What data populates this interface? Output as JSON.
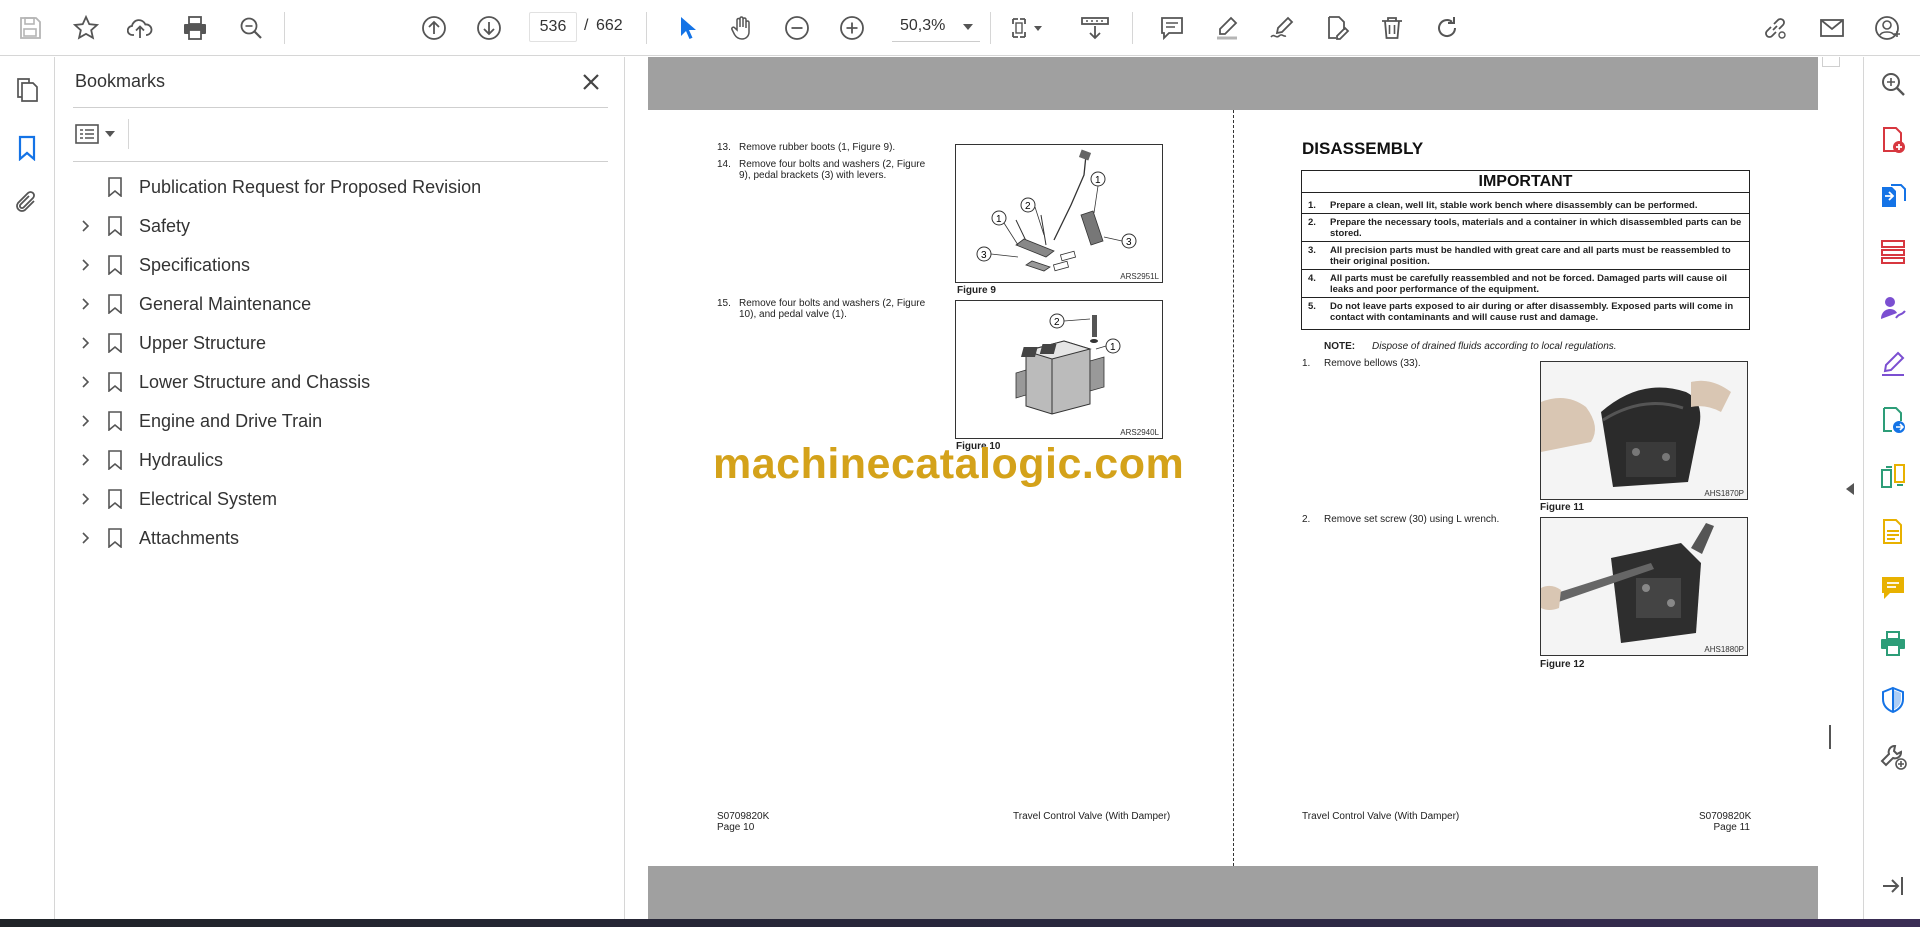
{
  "toolbar": {
    "current_page": "536",
    "page_separator": "/",
    "total_pages": "662",
    "zoom": "50,3%"
  },
  "bookmarks": {
    "title": "Bookmarks",
    "items": [
      {
        "label": "Publication Request for Proposed Revision",
        "expandable": false
      },
      {
        "label": "Safety",
        "expandable": true
      },
      {
        "label": "Specifications",
        "expandable": true
      },
      {
        "label": "General Maintenance",
        "expandable": true
      },
      {
        "label": "Upper Structure",
        "expandable": true
      },
      {
        "label": "Lower Structure and Chassis",
        "expandable": true
      },
      {
        "label": "Engine and Drive Train",
        "expandable": true
      },
      {
        "label": "Hydraulics",
        "expandable": true
      },
      {
        "label": "Electrical System",
        "expandable": true
      },
      {
        "label": "Attachments",
        "expandable": true
      }
    ]
  },
  "left_page": {
    "steps": [
      {
        "num": "13.",
        "text": "Remove rubber boots (1, Figure 9)."
      },
      {
        "num": "14.",
        "line1": "Remove four bolts and washers (2, Figure",
        "line2": "9), pedal brackets (3) with levers."
      },
      {
        "num": "15.",
        "line1": "Remove four bolts and washers (2, Figure",
        "line2": "10), and pedal valve (1)."
      }
    ],
    "figures": [
      {
        "caption": "Figure 9",
        "code": "ARS2951L"
      },
      {
        "caption": "Figure 10",
        "code": "ARS2940L"
      }
    ],
    "footer": {
      "doc_no": "S0709820K",
      "page": "Page 10",
      "title": "Travel Control Valve (With Damper)"
    }
  },
  "right_page": {
    "heading": "DISASSEMBLY",
    "important": {
      "title": "IMPORTANT",
      "items": [
        {
          "num": "1.",
          "line1": "Prepare a clean, well lit, stable work bench where disassembly can be performed.",
          "line2": ""
        },
        {
          "num": "2.",
          "line1": "Prepare the necessary tools, materials and a container in which disassembled parts can be",
          "line2": "stored."
        },
        {
          "num": "3.",
          "line1": "All precision parts must be handled with great care and all parts must be reassembled to",
          "line2": "their original position."
        },
        {
          "num": "4.",
          "line1": "All parts must be carefully reassembled and not be forced. Damaged parts will cause oil",
          "line2": "leaks and poor performance of the equipment."
        },
        {
          "num": "5.",
          "line1": "Do not leave parts exposed to air during or after disassembly. Exposed parts will come in",
          "line2": "contact with contaminants and will cause rust and damage."
        }
      ]
    },
    "note_label": "NOTE:",
    "note_text": "Dispose of drained fluids according to local regulations.",
    "steps": [
      {
        "num": "1.",
        "text": "Remove bellows (33)."
      },
      {
        "num": "2.",
        "text": "Remove set screw (30) using L wrench."
      }
    ],
    "figures": [
      {
        "caption": "Figure 11",
        "code": "AHS1870P"
      },
      {
        "caption": "Figure 12",
        "code": "AHS1880P"
      }
    ],
    "footer": {
      "doc_no": "S0709820K",
      "page": "Page 11",
      "title": "Travel Control Valve (With Damper)"
    }
  },
  "watermark": "machinecatalogic.com",
  "icons": {
    "toolbar": [
      "save-icon",
      "bookmark-star-icon",
      "upload-cloud-icon",
      "print-icon",
      "search-zoom-icon",
      "page-up-icon",
      "page-down-icon",
      "select-cursor-icon",
      "hand-tool-icon",
      "zoom-out-icon",
      "zoom-in-icon",
      "fit-page-icon",
      "scroll-mode-icon",
      "comment-icon",
      "highlight-pen-icon",
      "sign-icon",
      "edit-pdf-icon",
      "delete-icon",
      "rotate-icon",
      "share-link-icon",
      "email-icon",
      "account-icon"
    ],
    "left_rail": [
      "page-thumbnails-icon",
      "bookmarks-icon",
      "attachments-icon"
    ],
    "right_rail": [
      "search-tool-icon",
      "create-pdf-icon",
      "export-pdf-icon",
      "organize-pages-icon",
      "request-signature-icon",
      "fill-sign-icon",
      "send-for-review-icon",
      "compare-files-icon",
      "scan-ocr-icon",
      "add-comment-icon",
      "print-production-icon",
      "protect-icon",
      "more-tools-icon",
      "collapse-panel-icon"
    ]
  },
  "colors": {
    "accent_blue": "#1473e6",
    "watermark_gold": "#d4a21a",
    "page_bg_gray": "#a0a0a0",
    "tool_red": "#d7373f",
    "tool_purple": "#7b4fd1",
    "tool_yellow": "#e8b100",
    "tool_green": "#2d9d78",
    "tool_blue": "#1473e6"
  }
}
